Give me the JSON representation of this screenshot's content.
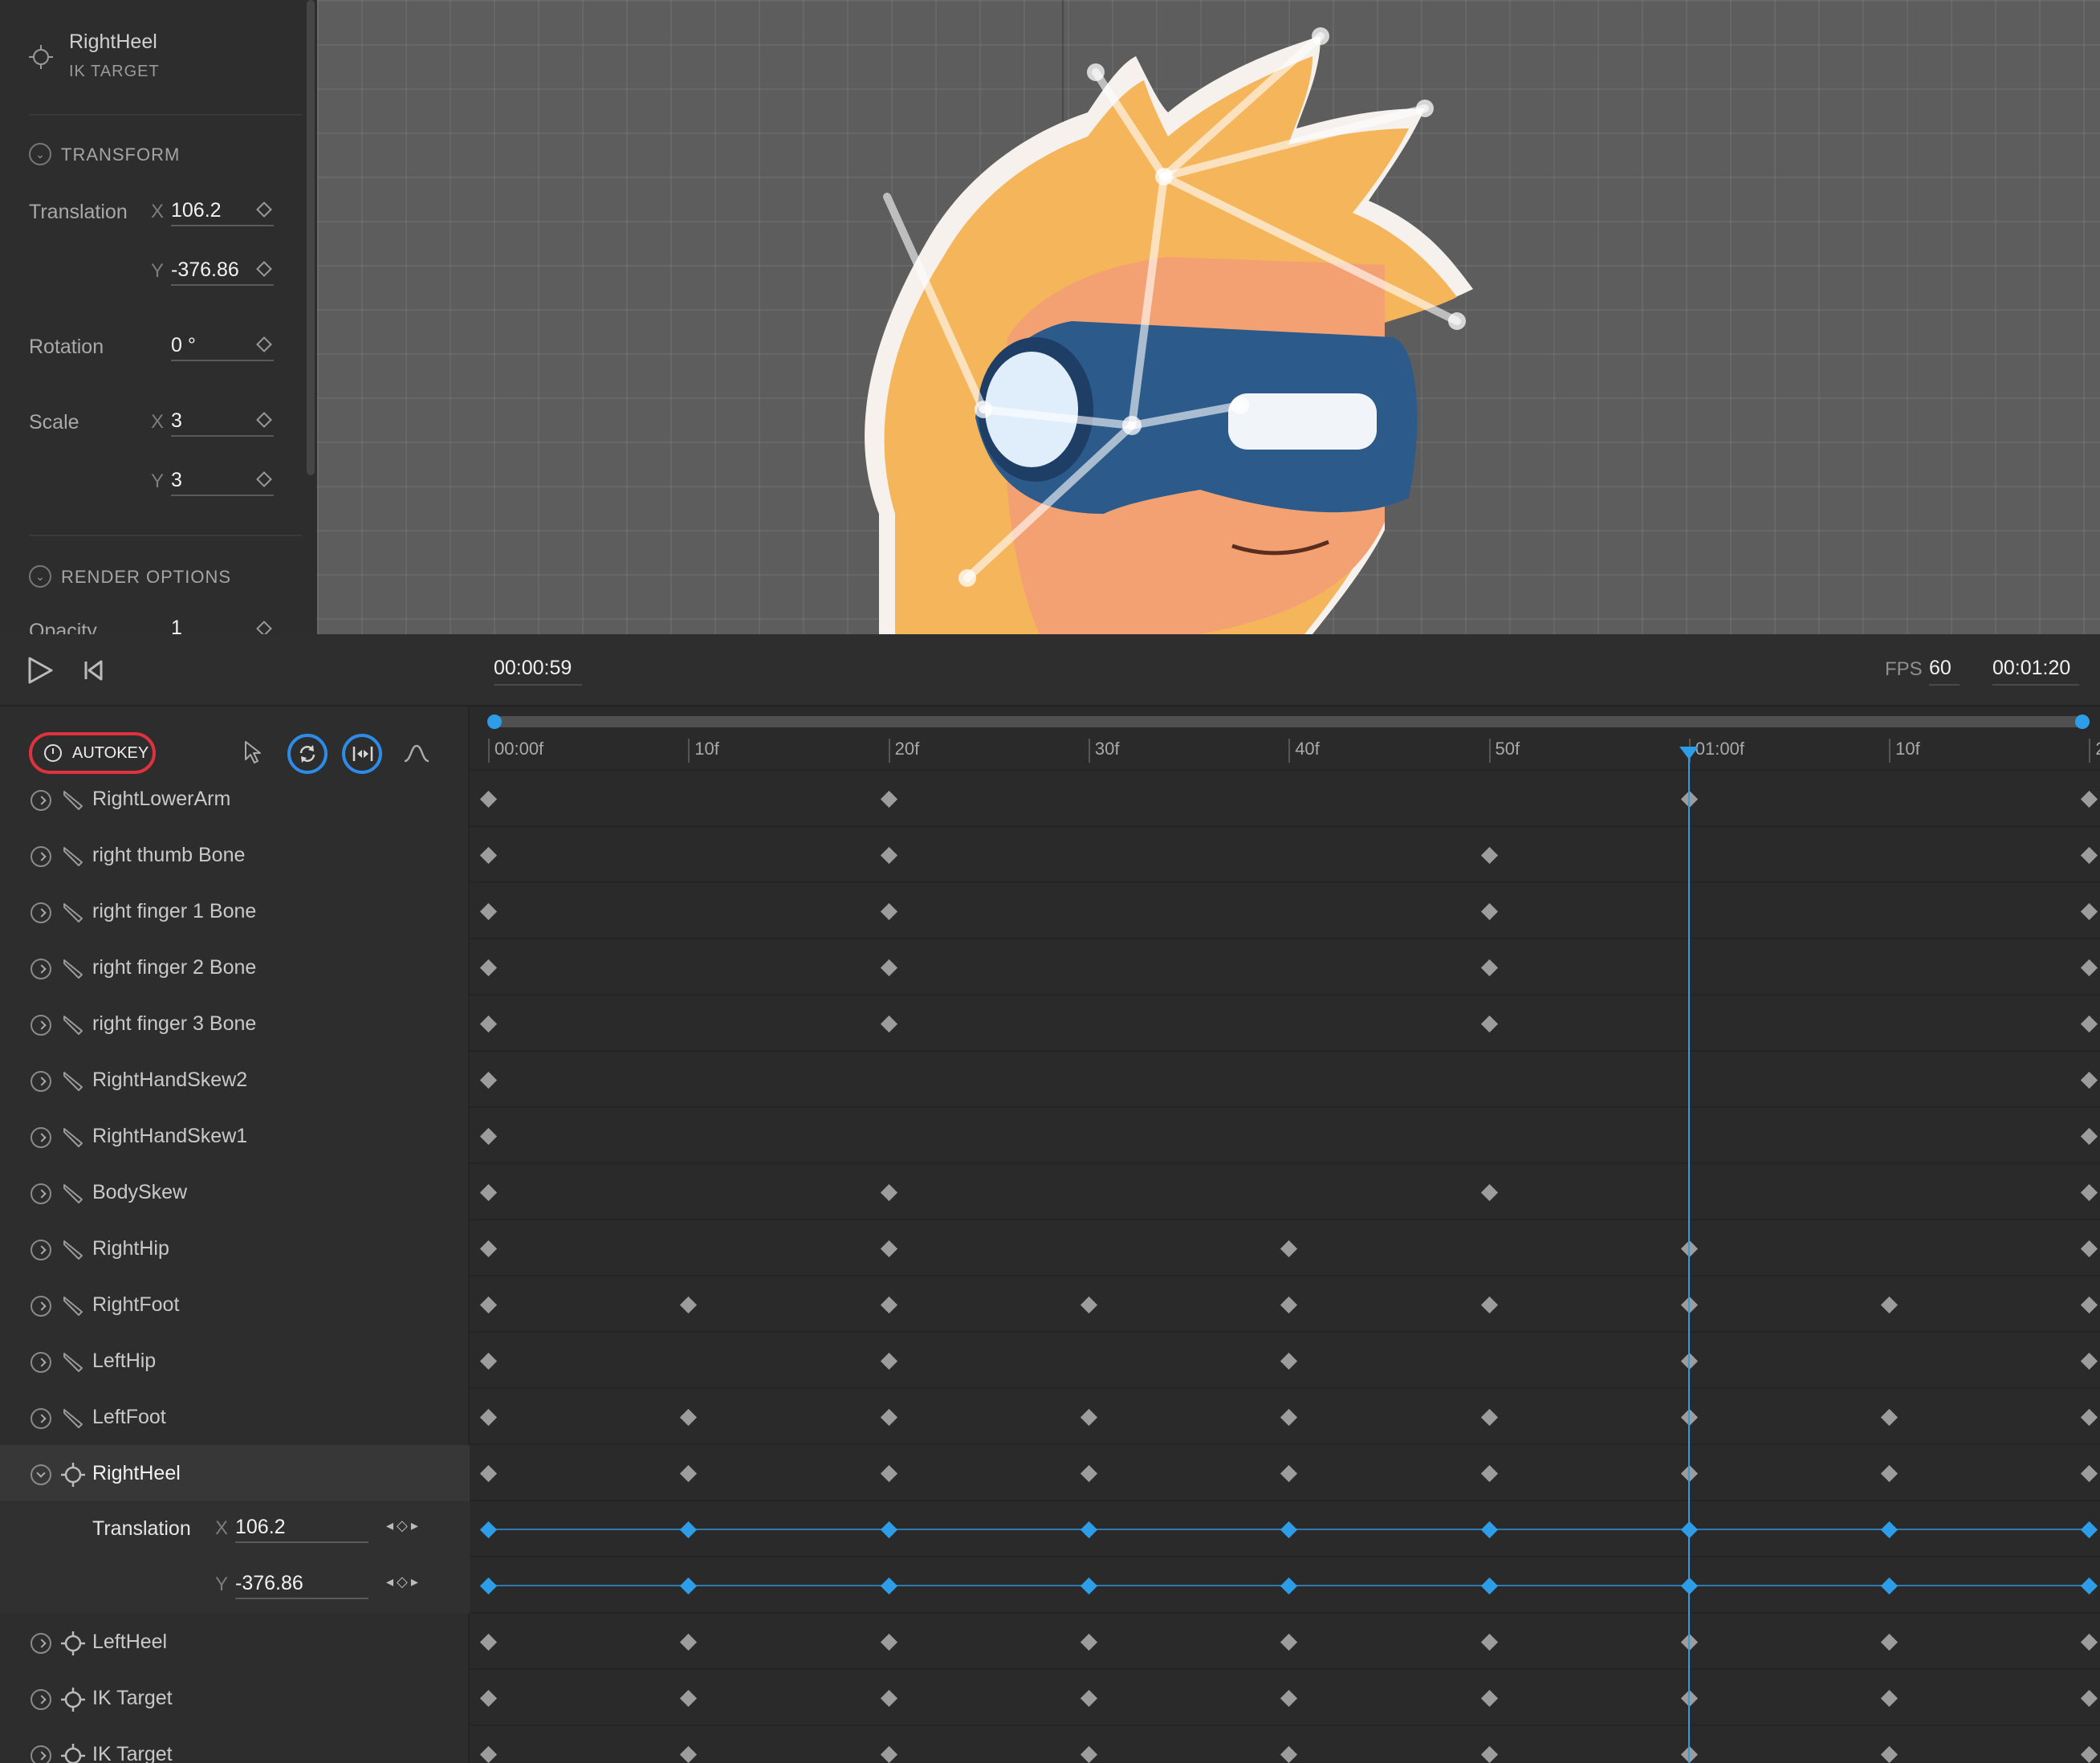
{
  "inspector": {
    "object_name": "RightHeel",
    "object_type": "IK TARGET",
    "sections": {
      "transform": "TRANSFORM",
      "render_options": "RENDER OPTIONS"
    },
    "translation_label": "Translation",
    "translation_x": "106.2",
    "translation_y": "-376.86",
    "rotation_label": "Rotation",
    "rotation": "0 °",
    "scale_label": "Scale",
    "scale_x": "3",
    "scale_y": "3",
    "opacity_label": "Opacity",
    "opacity": "1",
    "axis_x": "X",
    "axis_y": "Y"
  },
  "timeline": {
    "current_time": "00:00:59",
    "fps_label": "FPS",
    "fps": "60",
    "duration": "00:01:20",
    "autokey_label": "AUTOKEY",
    "ruler_ticks": [
      "00:00f",
      "10f",
      "20f",
      "30f",
      "40f",
      "50f",
      "01:00f",
      "10f",
      "2"
    ],
    "playhead_frame": 60,
    "tracks": [
      {
        "name": "RightLowerArm",
        "icon": "bone-icon",
        "keys": [
          0,
          20,
          60,
          80
        ]
      },
      {
        "name": "right thumb Bone",
        "icon": "bone-icon",
        "keys": [
          0,
          20,
          50,
          80
        ]
      },
      {
        "name": "right finger 1 Bone",
        "icon": "bone-icon",
        "keys": [
          0,
          20,
          50,
          80
        ]
      },
      {
        "name": "right finger 2 Bone",
        "icon": "bone-icon",
        "keys": [
          0,
          20,
          50,
          80
        ]
      },
      {
        "name": "right finger 3 Bone",
        "icon": "bone-icon",
        "keys": [
          0,
          20,
          50,
          80
        ]
      },
      {
        "name": "RightHandSkew2",
        "icon": "bone-icon",
        "keys": [
          0,
          80
        ]
      },
      {
        "name": "RightHandSkew1",
        "icon": "bone-icon",
        "keys": [
          0,
          80
        ]
      },
      {
        "name": "BodySkew",
        "icon": "bone-icon",
        "keys": [
          0,
          20,
          50,
          80
        ]
      },
      {
        "name": "RightHip",
        "icon": "bone-icon",
        "keys": [
          0,
          20,
          40,
          60,
          80
        ]
      },
      {
        "name": "RightFoot",
        "icon": "bone-icon",
        "keys": [
          0,
          10,
          20,
          30,
          40,
          50,
          60,
          70,
          80
        ]
      },
      {
        "name": "LeftHip",
        "icon": "bone-icon",
        "keys": [
          0,
          20,
          40,
          60,
          80
        ]
      },
      {
        "name": "LeftFoot",
        "icon": "bone-icon",
        "keys": [
          0,
          10,
          20,
          30,
          40,
          50,
          60,
          70,
          80
        ]
      },
      {
        "name": "RightHeel",
        "icon": "ik-target-icon",
        "selected": true,
        "keys": [
          0,
          10,
          20,
          30,
          40,
          50,
          60,
          70,
          80
        ]
      },
      {
        "name": "LeftHeel",
        "icon": "ik-target-icon",
        "keys": [
          0,
          10,
          20,
          30,
          40,
          50,
          60,
          70,
          80
        ]
      },
      {
        "name": "IK Target",
        "icon": "ik-target-icon",
        "keys": [
          0,
          10,
          20,
          30,
          40,
          50,
          60,
          70,
          80
        ]
      },
      {
        "name": "IK Target",
        "icon": "ik-target-icon",
        "keys": [
          0,
          10,
          20,
          30,
          40,
          50,
          60,
          70,
          80
        ]
      }
    ],
    "subtracks": {
      "translation_label": "Translation",
      "x_label": "X",
      "x_value": "106.2",
      "y_label": "Y",
      "y_value": "-376.86",
      "keys": [
        0,
        10,
        20,
        30,
        40,
        50,
        60,
        70,
        80
      ]
    }
  },
  "colors": {
    "accent_blue": "#2d9de8",
    "autokey_red": "#e0313f"
  }
}
